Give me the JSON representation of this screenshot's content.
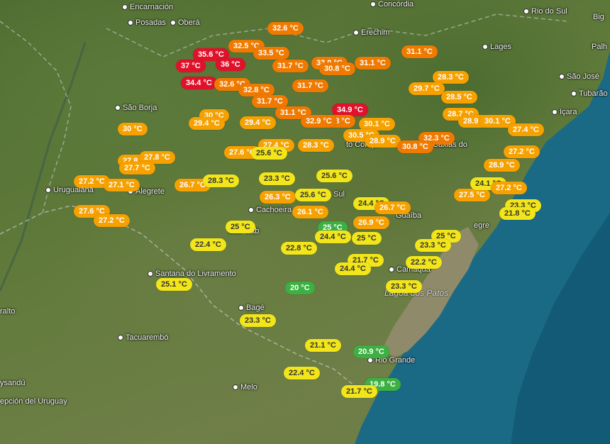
{
  "colors": {
    "hot": "#e0122b",
    "orange": "#f07a00",
    "light_orange": "#f7a100",
    "yellow": "#f2e51a",
    "green": "#3cb043"
  },
  "places": [
    {
      "name": "Encarnación"
    },
    {
      "name": "Posadas"
    },
    {
      "name": "Oberá"
    },
    {
      "name": "Concórdia"
    },
    {
      "name": "Rio do Sul"
    },
    {
      "name": "Erechim"
    },
    {
      "name": "Lages"
    },
    {
      "name": "São José"
    },
    {
      "name": "Tubarão"
    },
    {
      "name": "Içara"
    },
    {
      "name": "São Borja"
    },
    {
      "name": "Uruguaiana"
    },
    {
      "name": "Alegrete"
    },
    {
      "name": "Cachoeira"
    },
    {
      "name": "Camaquã"
    },
    {
      "name": "Santana do Livramento"
    },
    {
      "name": "Bagé"
    },
    {
      "name": "Tacuarembó"
    },
    {
      "name": "Melo"
    },
    {
      "name": "Rio Grande"
    },
    {
      "name": "ralto"
    },
    {
      "name": "ysandú"
    },
    {
      "name": "epción del Uruguay"
    },
    {
      "name": "Palh"
    },
    {
      "name": "Big"
    },
    {
      "name": "Guaíba"
    },
    {
      "name": "São Gab"
    },
    {
      "name": "egre"
    },
    {
      "name": "Sul"
    },
    {
      "name": "Caxias do"
    },
    {
      "name": "to Conqui"
    }
  ],
  "lagoa": "Lagoa dos Patos",
  "readings": [
    {
      "t": "32.6 °C",
      "c": "orange"
    },
    {
      "t": "31.1 °C",
      "c": "orange"
    },
    {
      "t": "32.5 °C",
      "c": "orange"
    },
    {
      "t": "35.6 °C",
      "c": "hot"
    },
    {
      "t": "33.5 °C",
      "c": "orange"
    },
    {
      "t": "37 °C",
      "c": "hot"
    },
    {
      "t": "36 °C",
      "c": "hot"
    },
    {
      "t": "31.7 °C",
      "c": "orange"
    },
    {
      "t": "32.9 °C",
      "c": "orange"
    },
    {
      "t": "31.1 °C",
      "c": "orange"
    },
    {
      "t": "30.8 °C",
      "c": "orange"
    },
    {
      "t": "28.3 °C",
      "c": "light_orange"
    },
    {
      "t": "34.4 °C",
      "c": "hot"
    },
    {
      "t": "32.6 °C",
      "c": "orange"
    },
    {
      "t": "32.8 °C",
      "c": "orange"
    },
    {
      "t": "31.7 °C",
      "c": "orange"
    },
    {
      "t": "29.7 °C",
      "c": "light_orange"
    },
    {
      "t": "28.5 °C",
      "c": "light_orange"
    },
    {
      "t": "31.7 °C",
      "c": "orange"
    },
    {
      "t": "34.9 °C",
      "c": "hot"
    },
    {
      "t": "30 °C",
      "c": "light_orange"
    },
    {
      "t": "31.1 °C",
      "c": "orange"
    },
    {
      "t": "32.8 °C",
      "c": "orange"
    },
    {
      "t": "29.4 °C",
      "c": "light_orange"
    },
    {
      "t": "29.4 °C",
      "c": "light_orange"
    },
    {
      "t": "32.9 °C",
      "c": "orange"
    },
    {
      "t": "30.1 °C",
      "c": "light_orange"
    },
    {
      "t": "28.7 °C",
      "c": "light_orange"
    },
    {
      "t": "28.9 °C",
      "c": "light_orange"
    },
    {
      "t": "30.1 °C",
      "c": "light_orange"
    },
    {
      "t": "27.4 °C",
      "c": "light_orange"
    },
    {
      "t": "30 °C",
      "c": "light_orange"
    },
    {
      "t": "30.5 °C",
      "c": "light_orange"
    },
    {
      "t": "32.3 °C",
      "c": "orange"
    },
    {
      "t": "28.9 °C",
      "c": "light_orange"
    },
    {
      "t": "30.8 °C",
      "c": "orange"
    },
    {
      "t": "27.4 °C",
      "c": "light_orange"
    },
    {
      "t": "28.3 °C",
      "c": "light_orange"
    },
    {
      "t": "27.6 °C",
      "c": "light_orange"
    },
    {
      "t": "25.6 °C",
      "c": "yellow"
    },
    {
      "t": "27.2 °C",
      "c": "light_orange"
    },
    {
      "t": "27.8 °C",
      "c": "light_orange"
    },
    {
      "t": "27.8 °C",
      "c": "light_orange"
    },
    {
      "t": "27.7 °C",
      "c": "light_orange"
    },
    {
      "t": "28.9 °C",
      "c": "light_orange"
    },
    {
      "t": "27.2 °C",
      "c": "light_orange"
    },
    {
      "t": "27.1 °C",
      "c": "light_orange"
    },
    {
      "t": "26.7 °C",
      "c": "light_orange"
    },
    {
      "t": "28.3 °C",
      "c": "yellow"
    },
    {
      "t": "23.3 °C",
      "c": "yellow"
    },
    {
      "t": "25.6 °C",
      "c": "yellow"
    },
    {
      "t": "27.5 °C",
      "c": "light_orange"
    },
    {
      "t": "24.1 °C",
      "c": "yellow"
    },
    {
      "t": "27.2 °C",
      "c": "light_orange"
    },
    {
      "t": "26.3 °C",
      "c": "light_orange"
    },
    {
      "t": "25.6 °C",
      "c": "yellow"
    },
    {
      "t": "23.3 °C",
      "c": "yellow"
    },
    {
      "t": "27.6 °C",
      "c": "light_orange"
    },
    {
      "t": "27.2 °C",
      "c": "light_orange"
    },
    {
      "t": "26.1 °C",
      "c": "light_orange"
    },
    {
      "t": "24.4 °C",
      "c": "yellow"
    },
    {
      "t": "26.7 °C",
      "c": "light_orange"
    },
    {
      "t": "21.8 °C",
      "c": "yellow"
    },
    {
      "t": "26.9 °C",
      "c": "light_orange"
    },
    {
      "t": "25 °C",
      "c": "yellow"
    },
    {
      "t": "25 °C",
      "c": "green"
    },
    {
      "t": "25 °C",
      "c": "yellow"
    },
    {
      "t": "22.4 °C",
      "c": "yellow"
    },
    {
      "t": "22.8 °C",
      "c": "yellow"
    },
    {
      "t": "24.4 °C",
      "c": "yellow"
    },
    {
      "t": "25 °C",
      "c": "yellow"
    },
    {
      "t": "23.3 °C",
      "c": "yellow"
    },
    {
      "t": "21.7 °C",
      "c": "yellow"
    },
    {
      "t": "22.2 °C",
      "c": "yellow"
    },
    {
      "t": "24.4 °C",
      "c": "yellow"
    },
    {
      "t": "25.1 °C",
      "c": "yellow"
    },
    {
      "t": "20 °C",
      "c": "green"
    },
    {
      "t": "23.3 °C",
      "c": "yellow"
    },
    {
      "t": "23.3 °C",
      "c": "yellow"
    },
    {
      "t": "21.1 °C",
      "c": "yellow"
    },
    {
      "t": "20.9 °C",
      "c": "green"
    },
    {
      "t": "22.4 °C",
      "c": "yellow"
    },
    {
      "t": "19.8 °C",
      "c": "green"
    },
    {
      "t": "21.7 °C",
      "c": "yellow"
    }
  ]
}
